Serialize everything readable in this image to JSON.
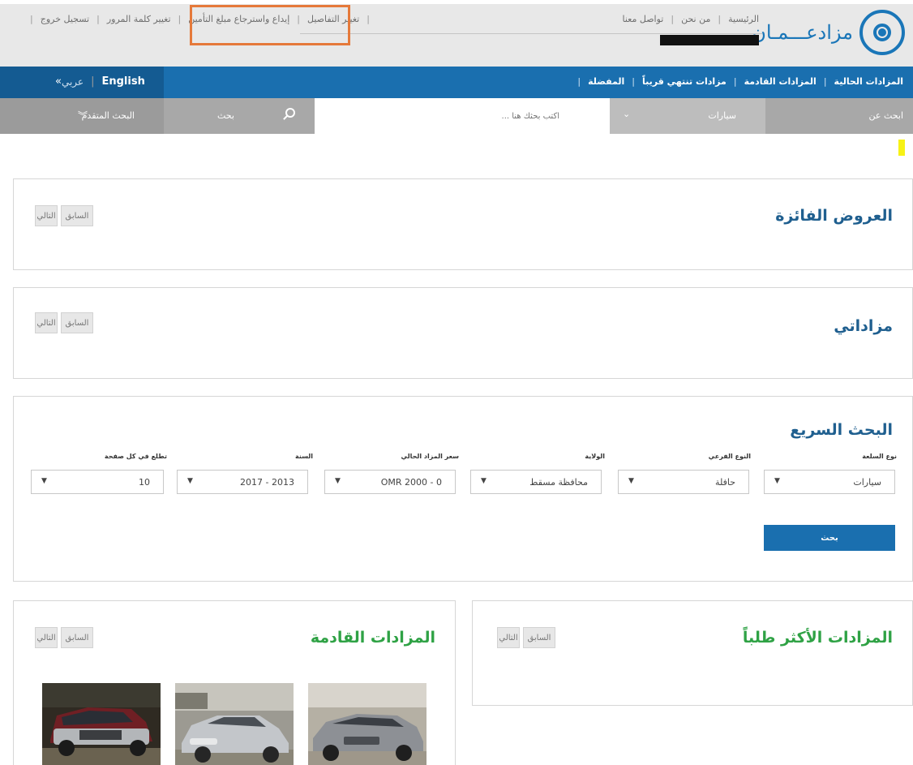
{
  "header": {
    "logo_text": "مزادعـــمـان",
    "nav_right": [
      "الرئيسية",
      "من نحن",
      "تواصل معنا"
    ],
    "nav_left": [
      "تغيير التفاصيل",
      "إيداع واسترجاع مبلغ التأمين",
      "تغيير كلمة المرور",
      "تسجيل خروج"
    ],
    "highlighted_item": "إيداع واسترجاع مبلغ التأمين"
  },
  "navbar": {
    "links": [
      "المزادات الحالية",
      "المزادات القادمة",
      "مزادات تنتهي قريباً",
      "المفضلة"
    ],
    "lang_en": "English",
    "lang_ar": "عربي",
    "lang_chevron": "»"
  },
  "searchbar": {
    "label": "ابحث عن",
    "category_value": "سيارات",
    "input_placeholder": "اكتب بحثك هنا ...",
    "search_label": "بحث",
    "advanced_label": "البحث المتقدم"
  },
  "panels": {
    "winning_offers": {
      "title": "العروض الفائزة",
      "prev": "السابق",
      "next": "التالي"
    },
    "my_auctions": {
      "title": "مزاداتي",
      "prev": "السابق",
      "next": "التالي"
    },
    "quick_search": {
      "title": "البحث السريع",
      "fields": [
        {
          "label": "نوع السلعة",
          "value": "سيارات"
        },
        {
          "label": "النوع الفرعي",
          "value": "حافلة"
        },
        {
          "label": "الولاية",
          "value": "محافظة مسقط"
        },
        {
          "label": "سعر المزاد الحالي",
          "value": "0 - 2000 OMR"
        },
        {
          "label": "السنة",
          "value": "2013 - 2017"
        },
        {
          "label": "تطلع في كل صفحة",
          "value": "10"
        }
      ],
      "submit": "بحث"
    },
    "most_wanted": {
      "title": "المزادات الأكثر طلباً",
      "prev": "السابق",
      "next": "التالي"
    },
    "upcoming": {
      "title": "المزادات القادمة",
      "prev": "السابق",
      "next": "التالي"
    }
  },
  "colors": {
    "brand_blue": "#1a6faf",
    "title_blue": "#1f5f8f",
    "green_title": "#2fa245",
    "highlight_orange": "#e5793a"
  },
  "icons": [
    "search-icon",
    "chevron-down-icon",
    "double-chevron-icon",
    "logo-icon"
  ]
}
